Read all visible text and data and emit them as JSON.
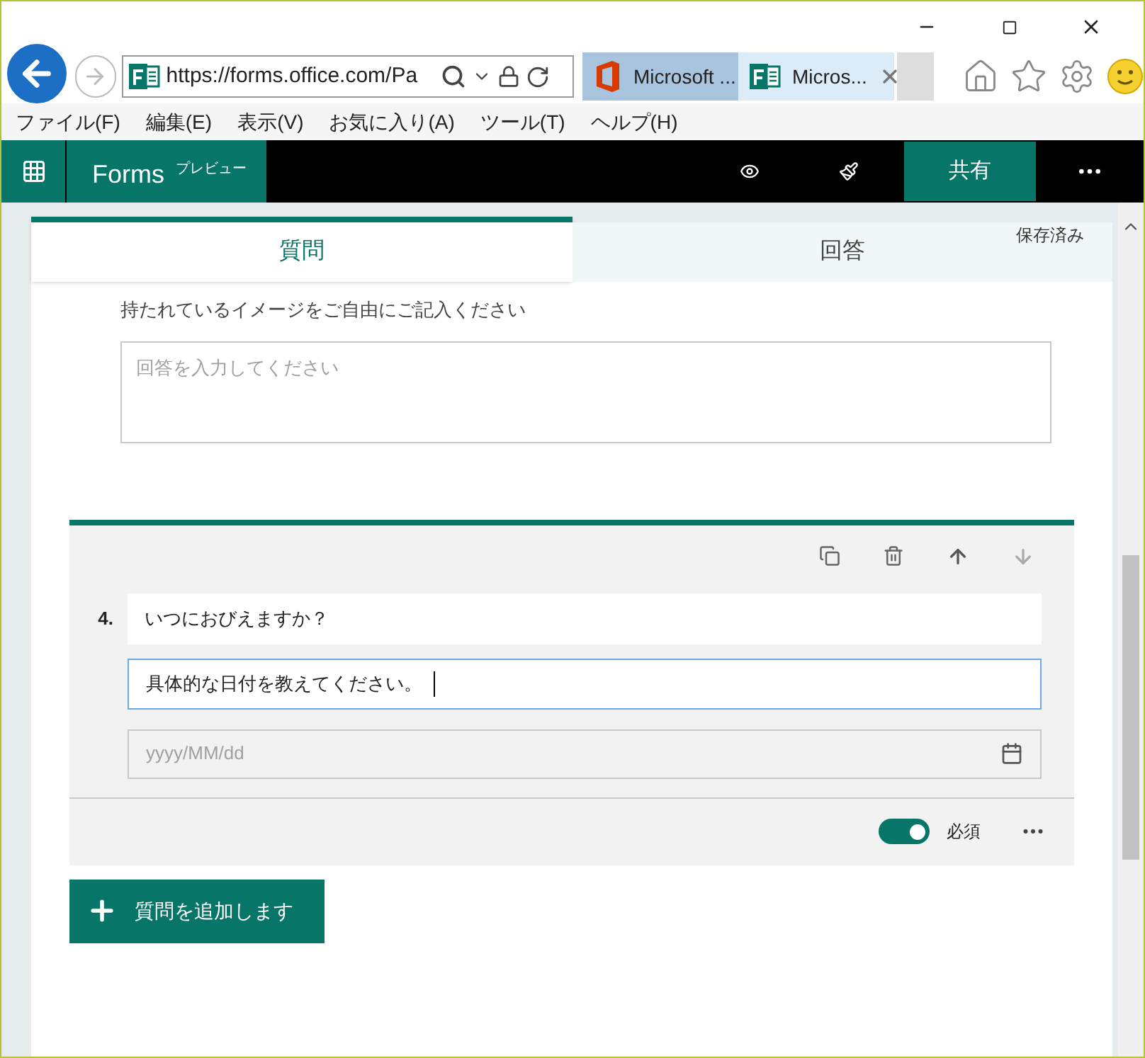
{
  "browser": {
    "address": "https://forms.office.com/Pa",
    "tabs": [
      {
        "label": "Microsoft ...",
        "selected": false,
        "kind": "office"
      },
      {
        "label": "Micros...",
        "selected": true,
        "kind": "forms"
      }
    ],
    "menu": [
      "ファイル(F)",
      "編集(E)",
      "表示(V)",
      "お気に入り(A)",
      "ツール(T)",
      "ヘルプ(H)"
    ]
  },
  "app_bar": {
    "title": "Forms",
    "badge": "プレビュー",
    "share": "共有"
  },
  "tabs": [
    {
      "label": "質問",
      "selected": true
    },
    {
      "label": "回答",
      "selected": false
    }
  ],
  "save_status": "保存済み",
  "question_3": {
    "subtitle": "持たれているイメージをご自由にご記入ください",
    "answer_placeholder": "回答を入力してください"
  },
  "question_4": {
    "number": "4.",
    "title": "いつにおびえますか？",
    "subtitle": "具体的な日付を教えてください。",
    "date_placeholder": "yyyy/MM/dd",
    "required": {
      "label": "必須",
      "on": true
    }
  },
  "add_button": "質問を追加します"
}
